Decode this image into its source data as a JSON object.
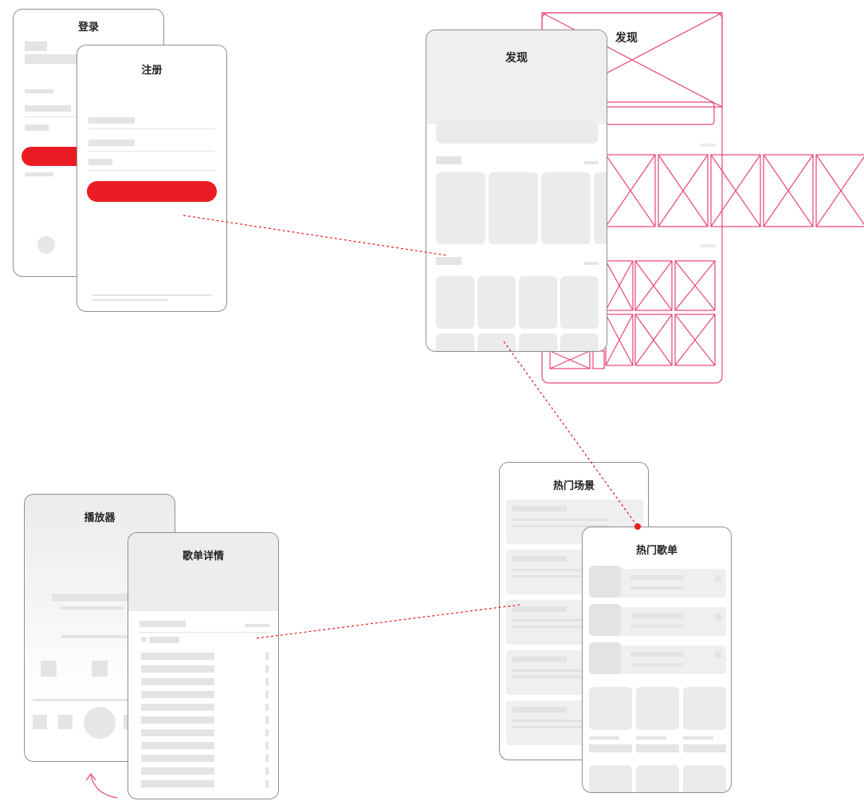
{
  "screens": {
    "login": {
      "title": "登录"
    },
    "register": {
      "title": "注册"
    },
    "discover": {
      "title": "发现"
    },
    "discover_wireframe": {
      "title": "发现"
    },
    "player": {
      "title": "播放器"
    },
    "playlist_detail": {
      "title": "歌单详情"
    },
    "hot_scenes": {
      "title": "热门场景"
    },
    "hot_playlists": {
      "title": "热门歌单"
    }
  },
  "colors": {
    "accent": "#e81c22",
    "wireframe": "#e8447a",
    "connector": "#e81c22",
    "frame": "#8e8e8e"
  }
}
